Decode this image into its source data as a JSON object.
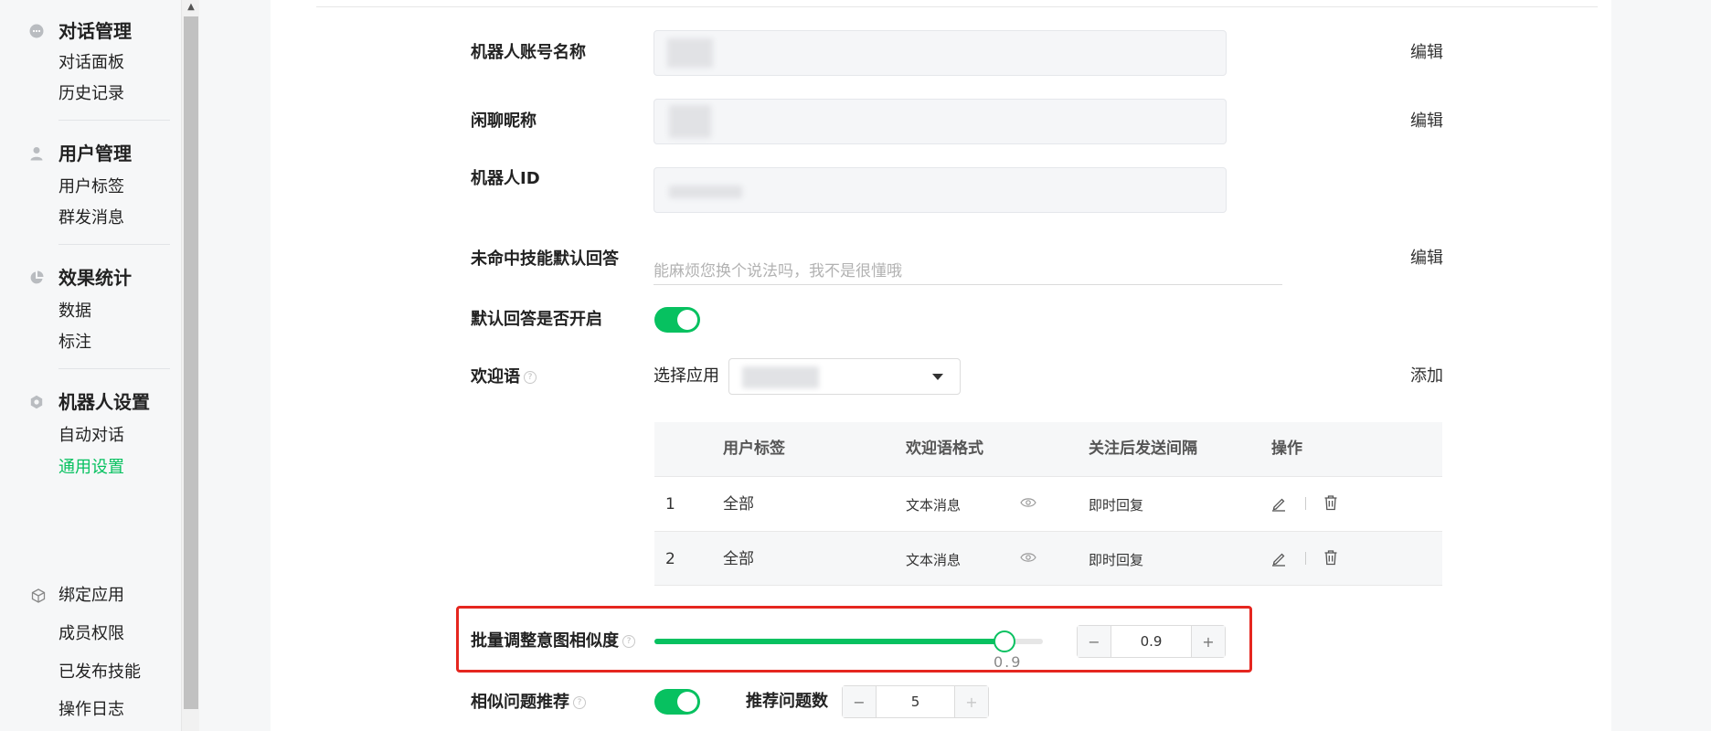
{
  "sidebar": {
    "groups": [
      {
        "title": "对话管理",
        "icon": "chat-bubble-icon",
        "items": [
          "对话面板",
          "历史记录"
        ]
      },
      {
        "title": "用户管理",
        "icon": "user-icon",
        "items": [
          "用户标签",
          "群发消息"
        ]
      },
      {
        "title": "效果统计",
        "icon": "pie-chart-icon",
        "items": [
          "数据",
          "标注"
        ]
      },
      {
        "title": "机器人设置",
        "icon": "gear-icon",
        "items": [
          "自动对话",
          "通用设置"
        ]
      }
    ],
    "extra": [
      {
        "label": "绑定应用",
        "icon": "cube-icon"
      },
      {
        "label": "成员权限"
      },
      {
        "label": "已发布技能"
      },
      {
        "label": "操作日志"
      }
    ],
    "active_item": "通用设置"
  },
  "form": {
    "account_name": {
      "label": "机器人账号名称",
      "action": "编辑"
    },
    "chat_nickname": {
      "label": "闲聊昵称",
      "action": "编辑"
    },
    "robot_id": {
      "label": "机器人ID"
    },
    "default_reply": {
      "label": "未命中技能默认回答",
      "placeholder": "能麻烦您换个说法吗，我不是很懂哦",
      "action": "编辑"
    },
    "default_reply_enabled": {
      "label": "默认回答是否开启",
      "on": true
    },
    "welcome": {
      "label": "欢迎语",
      "select_label": "选择应用",
      "action": "添加"
    }
  },
  "welcome_table": {
    "headers": [
      "用户标签",
      "欢迎语格式",
      "关注后发送间隔",
      "操作"
    ],
    "rows": [
      {
        "index": "1",
        "tag": "全部",
        "format": "文本消息",
        "interval": "即时回复"
      },
      {
        "index": "2",
        "tag": "全部",
        "format": "文本消息",
        "interval": "即时回复"
      }
    ]
  },
  "similarity": {
    "label": "批量调整意图相似度",
    "value": 0.9,
    "value_label": "0.9",
    "stepper_value": "0.9",
    "minus": "−",
    "plus": "+"
  },
  "recommend": {
    "label": "相似问题推荐",
    "on": true,
    "count_label": "推荐问题数",
    "count_value": "5",
    "minus": "−",
    "plus": "+"
  },
  "colors": {
    "accent": "#07c160",
    "highlight": "#e5261f",
    "sidebar_bg": "#f6f7f8"
  }
}
